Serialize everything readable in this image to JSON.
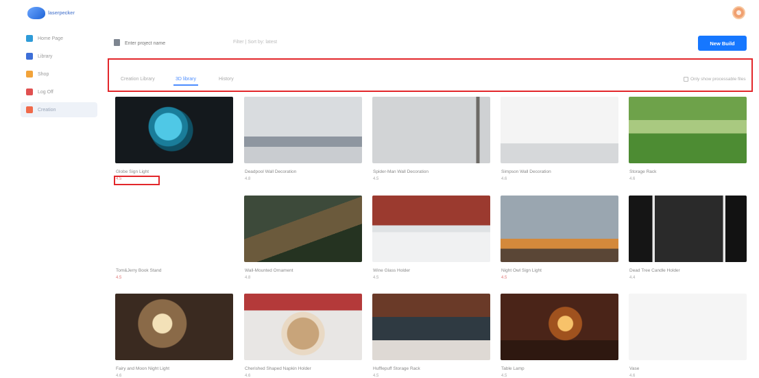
{
  "app": {
    "logo_text": "laserpecker"
  },
  "sidebar": {
    "items": [
      {
        "label": "Home Page",
        "icon": "home-icon",
        "color": "#2f9bd8"
      },
      {
        "label": "Library",
        "icon": "library-icon",
        "color": "#3d6fd8"
      },
      {
        "label": "Shop",
        "icon": "shop-icon",
        "color": "#f2a33a"
      },
      {
        "label": "Log Off",
        "icon": "logoff-icon",
        "color": "#e05050"
      },
      {
        "label": "Creation",
        "icon": "creation-icon",
        "color": "#f06a4a"
      }
    ],
    "active_index": 4
  },
  "toolbar": {
    "search_placeholder": "Enter project name",
    "meta_text": "Filter  |  Sort by: latest",
    "new_button": "New Build"
  },
  "tabs": {
    "items": [
      "Creation Library",
      "3D library",
      "History"
    ],
    "active_index": 1,
    "right_label": "Only show processable files"
  },
  "cards": [
    {
      "title": "Globe Sign Light",
      "sub": "4.5",
      "red": true,
      "highlight": true,
      "thumb": "globe"
    },
    {
      "title": "Deadpool Wall Decoration",
      "sub": "4.8",
      "red": false,
      "thumb": "deadpool"
    },
    {
      "title": "Spider-Man Wall Decoration",
      "sub": "4.5",
      "red": false,
      "thumb": "spider"
    },
    {
      "title": "Simpson Wall Decoration",
      "sub": "4.6",
      "red": false,
      "thumb": "simpson"
    },
    {
      "title": "Storage Rack",
      "sub": "4.6",
      "red": false,
      "thumb": "rack"
    },
    {
      "title": "Tom&Jerry Book Stand",
      "sub": "4.5",
      "red": true,
      "thumb": "tomjerry"
    },
    {
      "title": "Wall-Mounted Ornament",
      "sub": "4.8",
      "red": false,
      "thumb": "wings"
    },
    {
      "title": "Wine Glass Holder",
      "sub": "4.5",
      "red": false,
      "thumb": "wine"
    },
    {
      "title": "Night Owl Sign Light",
      "sub": "4.5",
      "red": true,
      "thumb": "owl"
    },
    {
      "title": "Dead Tree Candle Holder",
      "sub": "4.4",
      "red": false,
      "thumb": "tree"
    },
    {
      "title": "Fairy and Moon Night Light",
      "sub": "4.6",
      "red": false,
      "thumb": "fairy"
    },
    {
      "title": "Cherished Shaped Napkin Holder",
      "sub": "4.6",
      "red": false,
      "thumb": "napkin"
    },
    {
      "title": "Hufflepuff Storage Rack",
      "sub": "4.5",
      "red": false,
      "thumb": "storage"
    },
    {
      "title": "Table Lamp",
      "sub": "4.5",
      "red": false,
      "thumb": "lamp"
    },
    {
      "title": "Vase",
      "sub": "4.6",
      "red": false,
      "thumb": "vase"
    }
  ]
}
